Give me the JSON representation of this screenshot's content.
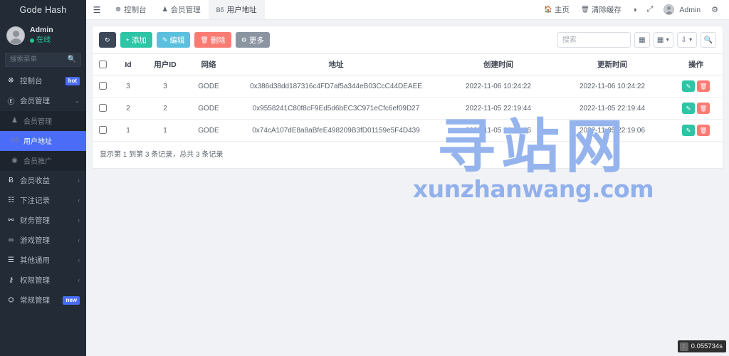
{
  "sidebar": {
    "brand": "Gode Hash",
    "profile": {
      "name": "Admin",
      "status": "在线"
    },
    "search_placeholder": "搜索菜单",
    "search_icon": "search-icon",
    "items": [
      {
        "label": "控制台",
        "icon": "dashboard-icon",
        "badge": "hot",
        "caret": ""
      },
      {
        "label": "会员管理",
        "icon": "user-circle-icon",
        "badge": "",
        "caret": "⌄"
      },
      {
        "label": "会员管理",
        "icon": "user-icon",
        "badge": "",
        "caret": "",
        "sub": true
      },
      {
        "label": "用户地址",
        "icon": "eth-icon",
        "badge": "",
        "caret": "",
        "sub": true,
        "active": true
      },
      {
        "label": "会员推广",
        "icon": "eye-icon",
        "badge": "",
        "caret": "",
        "sub": true
      },
      {
        "label": "会员收益",
        "icon": "coin-icon",
        "badge": "",
        "caret": "‹"
      },
      {
        "label": "下注记录",
        "icon": "calendar-icon",
        "badge": "",
        "caret": "‹"
      },
      {
        "label": "财务管理",
        "icon": "finance-icon",
        "badge": "",
        "caret": "‹"
      },
      {
        "label": "游戏管理",
        "icon": "game-icon",
        "badge": "",
        "caret": "‹"
      },
      {
        "label": "其他通用",
        "icon": "list-icon",
        "badge": "",
        "caret": "‹"
      },
      {
        "label": "权限管理",
        "icon": "key-icon",
        "badge": "",
        "caret": "‹"
      },
      {
        "label": "常规管理",
        "icon": "gears-icon",
        "badge": "new",
        "caret": ""
      }
    ]
  },
  "topbar": {
    "hamburger_icon": "hamburger-icon",
    "tabs": [
      {
        "label": "控制台",
        "icon": "dashboard-icon",
        "active": false
      },
      {
        "label": "会员管理",
        "icon": "user-icon",
        "active": false
      },
      {
        "label": "用户地址",
        "icon": "eth-icon",
        "active": true
      }
    ],
    "right_links": [
      {
        "label": "主页",
        "icon": "home-icon"
      },
      {
        "label": "清除缓存",
        "icon": "trash-icon"
      }
    ],
    "right_icons": [
      {
        "name": "theme-icon",
        "glyph": "◐"
      },
      {
        "name": "fullscreen-icon",
        "glyph": "⤢"
      }
    ],
    "user": {
      "label": "Admin",
      "avatar": "avatar"
    },
    "settings_icon": "gears-icon"
  },
  "toolbar": {
    "refresh": {
      "label": "",
      "icon": "refresh-icon"
    },
    "add": {
      "label": "添加",
      "icon": "plus-icon"
    },
    "edit": {
      "label": "编辑",
      "icon": "pencil-icon"
    },
    "delete": {
      "label": "删除",
      "icon": "trash-icon"
    },
    "more": {
      "label": "更多",
      "icon": "gear-icon"
    },
    "search_placeholder": "搜索",
    "columns_icon": "columns-icon",
    "grid_icon": "grid-icon",
    "export_icon": "export-icon",
    "search_icon": "search-icon",
    "colors": {
      "refresh": "#3c4858",
      "add": "#2ec4a6",
      "edit": "#5bc0de",
      "delete": "#f97b72",
      "more": "#8b95a1",
      "accent": "#4a6cf7"
    }
  },
  "table": {
    "columns": [
      "",
      "Id",
      "用户ID",
      "网络",
      "地址",
      "创建时间",
      "更新时间",
      "操作"
    ],
    "rows": [
      {
        "id": "3",
        "user_id": "3",
        "network": "GODE",
        "address": "0x386d38dd187316c4FD7af5a344eB03CcC44DEAEE",
        "created": "2022-11-06 10:24:22",
        "updated": "2022-11-06 10:24:22"
      },
      {
        "id": "2",
        "user_id": "2",
        "network": "GODE",
        "address": "0x9558241C80f8cF9Ed5d6bEC3C971eCfc6ef09D27",
        "created": "2022-11-05 22:19:44",
        "updated": "2022-11-05 22:19:44"
      },
      {
        "id": "1",
        "user_id": "1",
        "network": "GODE",
        "address": "0x74cA107dE8a8aBfeE498209B3fD01159e5F4D439",
        "created": "2022-11-05 22:19:06",
        "updated": "2022-11-05 22:19:06"
      }
    ],
    "row_actions": {
      "edit_icon": "pencil-icon",
      "delete_icon": "trash-icon"
    },
    "footer": "显示第 1 到第 3 条记录，总共 3 条记录"
  },
  "watermark": {
    "cn": "寻站网",
    "en": "xunzhanwang.com"
  },
  "profiler": {
    "time": "0.055734s",
    "logo": "debugbar-icon"
  }
}
